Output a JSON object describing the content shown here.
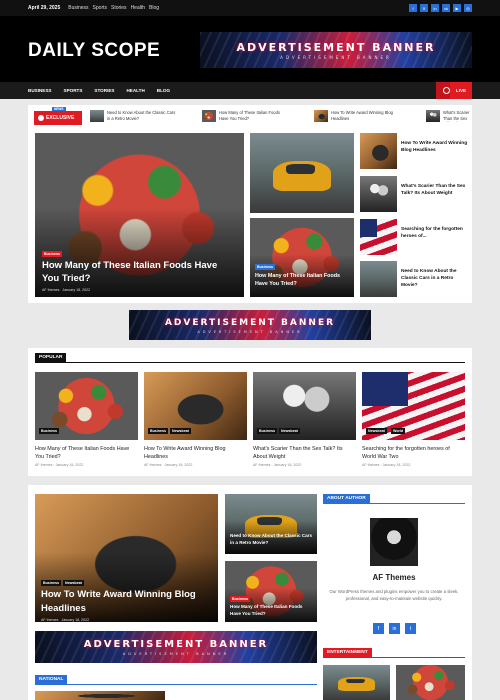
{
  "topbar": {
    "date": "April 29, 2025",
    "links": [
      "Business",
      "Sports",
      "Stories",
      "Health",
      "Blog"
    ],
    "socials": [
      "facebook-icon",
      "x-icon",
      "linkedin-icon",
      "vk-icon",
      "youtube-icon",
      "instagram-icon"
    ]
  },
  "header": {
    "logo": "DAILY SCOPE",
    "banner_text": "ADVERTISEMENT BANNER",
    "banner_sub": "ADVERTISEMENT BANNER"
  },
  "nav": {
    "items": [
      "BUSINESS",
      "SPORTS",
      "STORIES",
      "HEALTH",
      "BLOG"
    ],
    "live": "LIVE"
  },
  "ticker": {
    "label": "EXCLUSIVE",
    "flag": "NEWS",
    "items": [
      "Need to Know About the Classic Cars in a Retro Movie?",
      "How Many of These Italian Foods Have You Tried?",
      "How To Write Award Winning Blog Headlines",
      "What's Scarier Than the Sex Talk? About We"
    ]
  },
  "featured": {
    "main": {
      "tag": "Business",
      "title": "How Many of These Italian Foods Have You Tried?",
      "author": "AF themes",
      "date": "January 18, 2022"
    },
    "small": {
      "tag": "Business",
      "title": "How Many of These Italian Foods Have You Tried?"
    },
    "side": [
      "How To Write Award Winning Blog Headlines",
      "What's Scarier Than the Sex Talk? Its About Weight",
      "Searching for the forgotten heroes of...",
      "Need to Know About the Classic Cars in a Retro Movie?"
    ]
  },
  "mid_banner": {
    "text": "ADVERTISEMENT BANNER",
    "sub": "ADVERTISEMENT BANNER"
  },
  "popular": {
    "heading": "POPULAR",
    "cards": [
      {
        "tags": [
          "Business"
        ],
        "title": "How Many of These Italian Foods Have You Tried?",
        "author": "AF themes",
        "date": "January 18, 2022"
      },
      {
        "tags": [
          "Business",
          "Newsbeat"
        ],
        "title": "How To Write Award Winning Blog Headlines",
        "author": "AF themes",
        "date": "January 18, 2022"
      },
      {
        "tags": [
          "Business",
          "Newsbeat"
        ],
        "title": "What's Scarier Than the Sex Talk? Its About Weight",
        "author": "AF themes",
        "date": "January 18, 2022"
      },
      {
        "tags": [
          "Newsbeat",
          "World"
        ],
        "title": "Searching for the forgotten heroes of World War Two",
        "author": "AF themes",
        "date": "January 18, 2022"
      }
    ]
  },
  "lower": {
    "main": {
      "tags": [
        "Business",
        "Newsbeat"
      ],
      "title": "How To Write Award Winning Blog Headlines",
      "author": "AF themes",
      "date": "January 18, 2022"
    },
    "right1": {
      "title": "Need to Know About the Classic Cars in a Retro Movie?"
    },
    "right2": {
      "tag": "Business",
      "title": "How Many of These Italian Foods Have You Tried?"
    },
    "banner_text": "ADVERTISEMENT BANNER",
    "banner_sub": "ADVERTISEMENT BANNER",
    "national": "NATIONAL"
  },
  "author": {
    "heading": "ABOUT AUTHOR",
    "name": "AF Themes",
    "desc": "Our WordPress themes and plugins empower you to create a sleek, professional, and easy-to-maintain website quickly.",
    "socials": [
      "facebook-icon",
      "linkedin-icon",
      "twitter-icon"
    ]
  },
  "entertainment": {
    "heading": "ENTERTAINMENT"
  },
  "colors": {
    "accent_red": "#e11b22",
    "accent_blue": "#2a6fd6",
    "dark": "#111111"
  }
}
